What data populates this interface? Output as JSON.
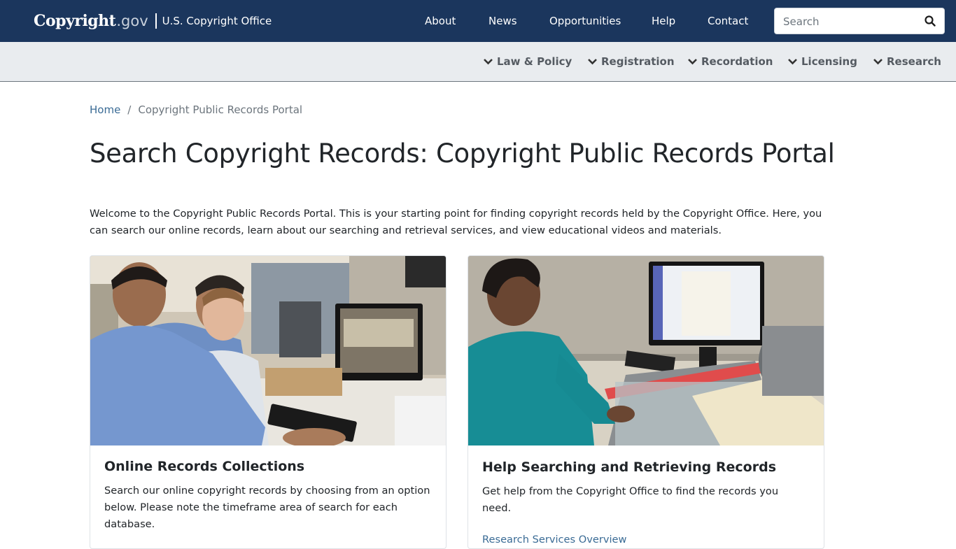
{
  "header": {
    "logo_mark": "Copyright",
    "logo_gov": ".gov",
    "logo_office": "U.S. Copyright Office",
    "nav": [
      "About",
      "News",
      "Opportunities",
      "Help",
      "Contact"
    ],
    "search_placeholder": "Search"
  },
  "subnav": [
    "Law & Policy",
    "Registration",
    "Recordation",
    "Licensing",
    "Research"
  ],
  "breadcrumb": {
    "home": "Home",
    "current": "Copyright Public Records Portal"
  },
  "page_title": "Search Copyright Records: Copyright Public Records Portal",
  "intro": "Welcome to the Copyright Public Records Portal. This is your starting point for finding copyright records held by the Copyright Office. Here, you can search our online records, learn about our searching and retrieval services, and view educational videos and materials.",
  "cards": [
    {
      "title": "Online Records Collections",
      "text": "Search our online copyright records by choosing from an option below. Please note the timeframe area of search for each database."
    },
    {
      "title": "Help Searching and Retrieving Records",
      "text": "Get help from the Copyright Office to find the records you need.",
      "link": "Research Services Overview"
    }
  ],
  "colors": {
    "navy": "#1b365d",
    "subbar": "#e9ecef",
    "link": "#3a6b95"
  },
  "icons": {
    "search": "search-icon",
    "chevron": "chevron-down-icon"
  }
}
